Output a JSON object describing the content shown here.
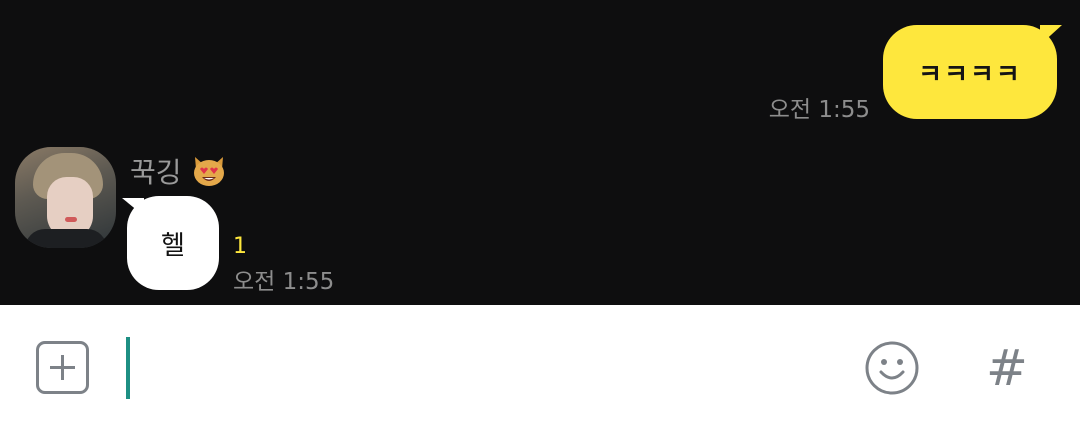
{
  "chat": {
    "outgoing": {
      "text": "ㅋㅋㅋㅋ",
      "time": "오전 1:55"
    },
    "incoming": {
      "sender": "꾹깅",
      "sender_emoji": "smiling-cat-heart-eyes-icon",
      "text": "헬",
      "unread": "1",
      "time": "오전 1:55"
    }
  },
  "input_bar": {
    "value": "",
    "icons": {
      "add": "plus-square-icon",
      "emoticon": "smiley-icon",
      "hashtag": "#"
    }
  },
  "colors": {
    "chat_background": "#0e0e0f",
    "outgoing_bubble": "#fee73d",
    "incoming_bubble": "#ffffff",
    "unread": "#fee73d",
    "caret": "#1d8f83"
  }
}
